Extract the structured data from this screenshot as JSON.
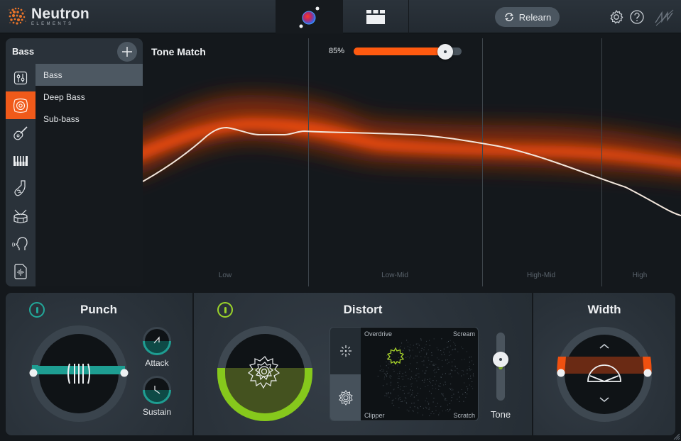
{
  "app": {
    "title": "Neutron",
    "subtitle": "ELEMENTS"
  },
  "topbar": {
    "views": [
      {
        "name": "tone-match-view",
        "icon": "orb-icon",
        "active": true
      },
      {
        "name": "mixer-view",
        "icon": "modules-icon",
        "active": false
      }
    ],
    "relearn_label": "Relearn",
    "icons": [
      "settings-icon",
      "help-icon",
      "izotope-logo-icon"
    ]
  },
  "instrument_panel": {
    "title": "Bass",
    "add_icon": "plus-icon",
    "categories": [
      {
        "name": "mixer-icon",
        "active": false
      },
      {
        "name": "bass-speaker-icon",
        "active": true
      },
      {
        "name": "guitar-icon",
        "active": false
      },
      {
        "name": "piano-icon",
        "active": false
      },
      {
        "name": "brass-icon",
        "active": false
      },
      {
        "name": "drum-icon",
        "active": false
      },
      {
        "name": "voice-icon",
        "active": false
      },
      {
        "name": "audio-file-icon",
        "active": false
      }
    ],
    "presets": [
      {
        "label": "Bass",
        "selected": true
      },
      {
        "label": "Deep Bass",
        "selected": false
      },
      {
        "label": "Sub-bass",
        "selected": false
      }
    ]
  },
  "tone_match": {
    "title": "Tone Match",
    "amount_label": "85%",
    "amount": 0.85,
    "bands": [
      "Low",
      "Low-Mid",
      "High-Mid",
      "High"
    ],
    "colors": {
      "accent": "#ff5a10",
      "curve": "#f2e6dc"
    }
  },
  "punch": {
    "title": "Punch",
    "enabled": true,
    "accent": "#22a89a",
    "attack_label": "Attack",
    "sustain_label": "Sustain"
  },
  "distort": {
    "title": "Distort",
    "enabled": true,
    "accent": "#9bd42a",
    "corners": {
      "top_left": "Overdrive",
      "top_right": "Scream",
      "bottom_left": "Clipper",
      "bottom_right": "Scratch"
    },
    "tone_label": "Tone",
    "tone_value": 0.6
  },
  "width": {
    "title": "Width",
    "accent": "#ff5a10"
  }
}
